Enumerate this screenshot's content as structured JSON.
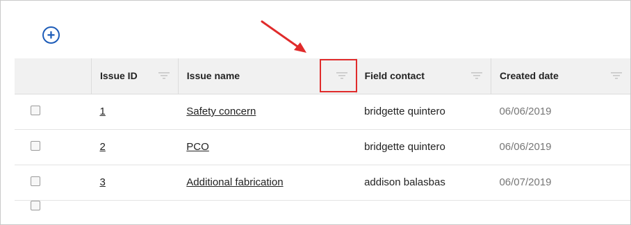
{
  "toolbar": {
    "add_icon": "plus-circle-icon",
    "add_glyph": "+"
  },
  "table": {
    "columns": [
      {
        "label": "",
        "filter_icon": ""
      },
      {
        "label": "Issue ID",
        "filter_icon": "filter-icon"
      },
      {
        "label": "Issue name",
        "filter_icon": "filter-icon"
      },
      {
        "label": "Field contact",
        "filter_icon": "filter-icon"
      },
      {
        "label": "Created date",
        "filter_icon": "filter-icon"
      }
    ],
    "rows": [
      {
        "checked": false,
        "id": "1",
        "name": "Safety concern",
        "contact": "bridgette quintero",
        "date": "06/06/2019"
      },
      {
        "checked": false,
        "id": "2",
        "name": "PCO",
        "contact": "bridgette quintero",
        "date": "06/06/2019"
      },
      {
        "checked": false,
        "id": "3",
        "name": "Additional fabrication",
        "contact": "addison balasbas",
        "date": "06/07/2019"
      }
    ]
  },
  "annotation": {
    "arrow_color": "#e02b2b",
    "box_color": "#e02b2b",
    "target": "Issue name filter"
  },
  "colors": {
    "accent": "#1d5cb8",
    "header_bg": "#f1f1f1",
    "muted_text": "#777777"
  }
}
